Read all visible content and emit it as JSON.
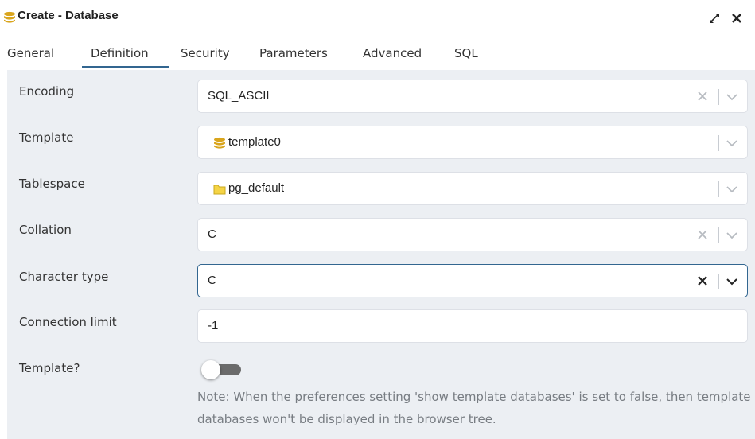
{
  "window": {
    "title": "Create - Database",
    "title_icon": "database-icon",
    "expand_icon": "expand-icon",
    "close_icon": "close-icon"
  },
  "tabs": [
    {
      "label": "General",
      "active": false
    },
    {
      "label": "Definition",
      "active": true
    },
    {
      "label": "Security",
      "active": false
    },
    {
      "label": "Parameters",
      "active": false
    },
    {
      "label": "Advanced",
      "active": false
    },
    {
      "label": "SQL",
      "active": false
    }
  ],
  "fields": {
    "encoding": {
      "label": "Encoding",
      "value": "SQL_ASCII"
    },
    "template": {
      "label": "Template",
      "value": "template0",
      "icon": "database-icon"
    },
    "tablespace": {
      "label": "Tablespace",
      "value": "pg_default",
      "icon": "folder-icon"
    },
    "collation": {
      "label": "Collation",
      "value": "C"
    },
    "character_type": {
      "label": "Character type",
      "value": "C"
    },
    "connection_limit": {
      "label": "Connection limit",
      "value": "-1"
    },
    "is_template": {
      "label": "Template?",
      "checked": false
    }
  },
  "note": "Note: When the preferences setting 'show template databases' is set to false, then template databases won't be displayed in the browser tree.",
  "colors": {
    "accent": "#326690",
    "panel_bg": "#eceff3",
    "database_icon": "#d9a51d",
    "folder_icon": "#f5d445",
    "toggle_off": "#6b6b6b"
  }
}
